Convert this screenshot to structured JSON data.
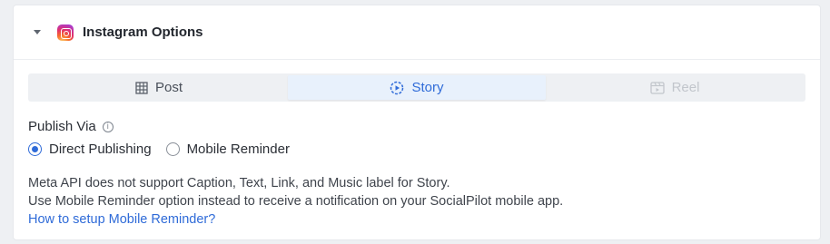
{
  "panel": {
    "title": "Instagram Options",
    "collapse_icon": "chevron-down-icon",
    "brand_icon": "instagram-icon"
  },
  "tabs": [
    {
      "label": "Post",
      "icon": "grid-icon",
      "state": "default"
    },
    {
      "label": "Story",
      "icon": "story-play-icon",
      "state": "active"
    },
    {
      "label": "Reel",
      "icon": "reel-icon",
      "state": "disabled"
    }
  ],
  "publish": {
    "label": "Publish Via",
    "options": [
      {
        "label": "Direct Publishing",
        "checked": true
      },
      {
        "label": "Mobile Reminder",
        "checked": false
      }
    ]
  },
  "notes": {
    "line1": "Meta API does not support Caption, Text, Link, and Music label for Story.",
    "line2": "Use Mobile Reminder option instead to receive a notification on your SocialPilot mobile app.",
    "link": "How to setup Mobile Reminder?"
  },
  "colors": {
    "accent": "#2f6bd8",
    "active_tab_bg": "#e8f1fc",
    "disabled_text": "#c2c6cc"
  }
}
